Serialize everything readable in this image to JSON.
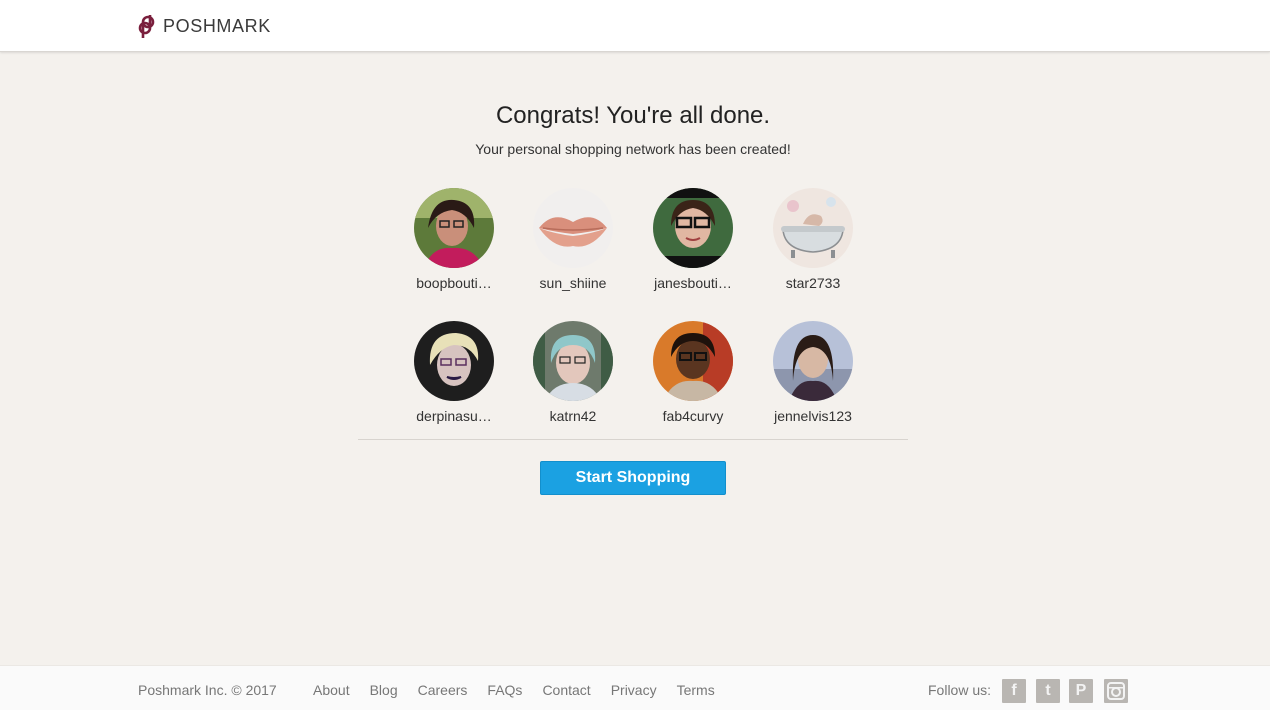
{
  "header": {
    "brand": "POSHMARK",
    "brand_color": "#7a1f3d"
  },
  "main": {
    "title": "Congrats! You're all done.",
    "subtitle": "Your personal shopping network has been created!",
    "users": [
      {
        "username": "boopbouti…",
        "avatar": "avatar-woman-glasses-outdoors"
      },
      {
        "username": "sun_shiine",
        "avatar": "avatar-lips-kiss"
      },
      {
        "username": "janesbouti…",
        "avatar": "avatar-woman-black-glasses"
      },
      {
        "username": "star2733",
        "avatar": "avatar-bathtub-illustration"
      },
      {
        "username": "derpinasu…",
        "avatar": "avatar-woman-purple-lipstick"
      },
      {
        "username": "katrn42",
        "avatar": "avatar-woman-blue-hair"
      },
      {
        "username": "fab4curvy",
        "avatar": "avatar-woman-selfie"
      },
      {
        "username": "jennelvis123",
        "avatar": "avatar-woman-dark-hair"
      }
    ],
    "cta_label": "Start Shopping",
    "cta_color": "#1ba1e2"
  },
  "footer": {
    "copyright": "Poshmark Inc. © 2017",
    "links": [
      "About",
      "Blog",
      "Careers",
      "FAQs",
      "Contact",
      "Privacy",
      "Terms"
    ],
    "follow_label": "Follow us:",
    "social": [
      {
        "name": "facebook-icon",
        "glyph": "f"
      },
      {
        "name": "twitter-icon",
        "glyph": "t"
      },
      {
        "name": "pinterest-icon",
        "glyph": "P"
      },
      {
        "name": "instagram-icon",
        "glyph": ""
      }
    ]
  }
}
